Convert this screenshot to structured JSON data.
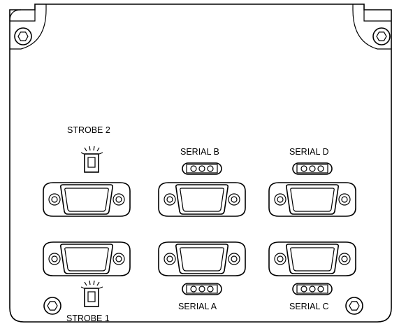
{
  "panel": {
    "labels": {
      "strobe2": "STROBE 2",
      "strobe1": "STROBE 1",
      "serialA": "SERIAL A",
      "serialB": "SERIAL B",
      "serialC": "SERIAL C",
      "serialD": "SERIAL D"
    },
    "icons": {
      "screw": "hex-screw-icon",
      "connector": "db9-connector-icon",
      "switch": "three-position-switch-icon",
      "led": "strobe-lamp-icon"
    },
    "colors": {
      "line": "#000000",
      "background": "#ffffff"
    }
  }
}
